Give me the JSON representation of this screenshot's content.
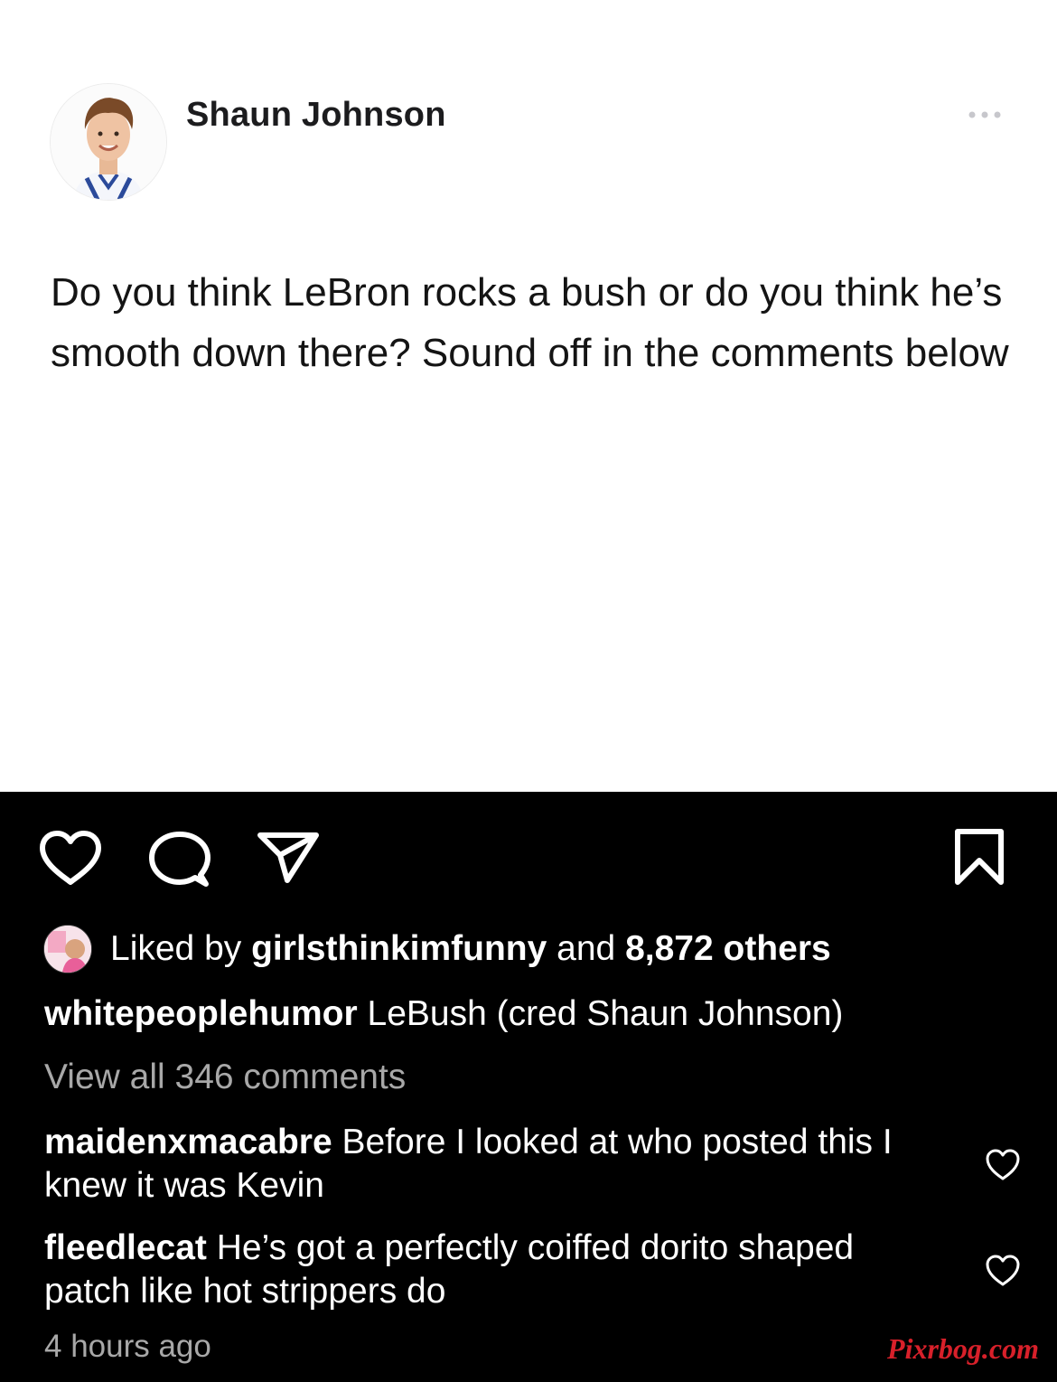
{
  "post": {
    "author": "Shaun Johnson",
    "text": "Do you think LeBron rocks a bush or do you think he’s smooth down there? Sound off in the comments below"
  },
  "actions": {
    "like_icon": "heart-icon",
    "comment_icon": "comment-icon",
    "share_icon": "send-icon",
    "save_icon": "bookmark-icon"
  },
  "likes": {
    "prefix": "Liked by",
    "user": "girlsthinkimfunny",
    "conjunction": "and",
    "others": "8,872 others"
  },
  "caption": {
    "user": "whitepeoplehumor",
    "text": "LeBush (cred Shaun Johnson)"
  },
  "view_all": "View all 346 comments",
  "comments": [
    {
      "user": "maidenxmacabre",
      "text": "Before I looked at who posted this I knew it was Kevin"
    },
    {
      "user": "fleedlecat",
      "text": "He’s got a perfectly coiffed dorito shaped patch like hot strippers do"
    }
  ],
  "timestamp": "4 hours ago",
  "watermark": "Pixrbog.com",
  "colors": {
    "background_top": "#ffffff",
    "background_bottom": "#000000",
    "muted_text": "#a8a8a8",
    "watermark": "#d8202a"
  }
}
